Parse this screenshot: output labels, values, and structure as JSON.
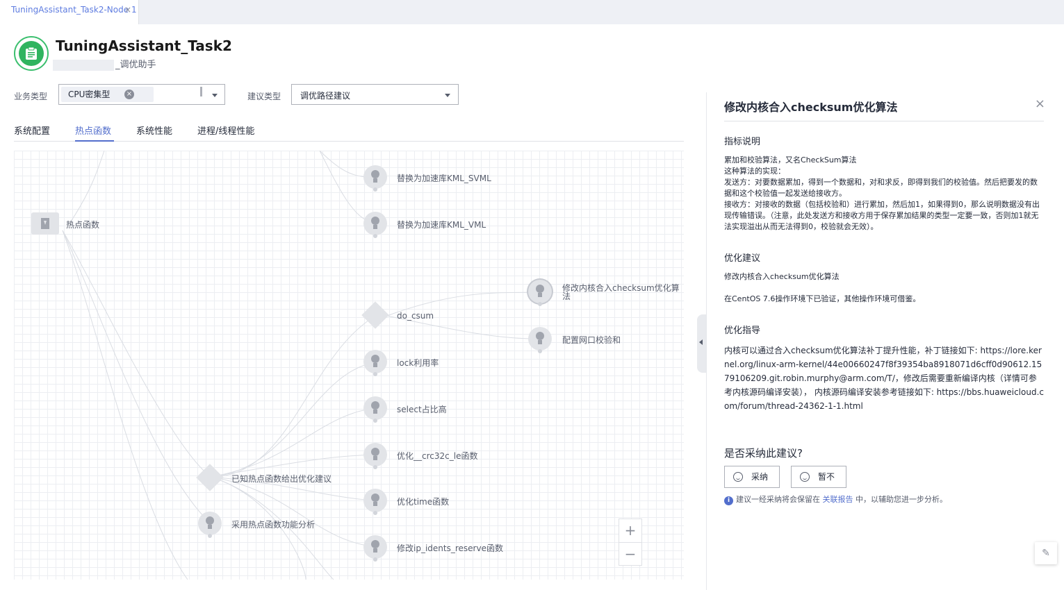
{
  "tab": {
    "label": "TuningAssistant_Task2-Node 1",
    "close": "×"
  },
  "header": {
    "title": "TuningAssistant_Task2",
    "subtitle": "_调优助手"
  },
  "filters": {
    "business_type_label": "业务类型",
    "business_type_value": "CPU密集型",
    "suggestion_type_label": "建议类型",
    "suggestion_type_value": "调优路径建议"
  },
  "nav": {
    "tabs": [
      "系统配置",
      "热点函数",
      "系统性能",
      "进程/线程性能"
    ],
    "active": "热点函数"
  },
  "graph": {
    "root": "热点函数",
    "nodes": {
      "svml": "替换为加速库KML_SVML",
      "vml": "替换为加速库KML_VML",
      "do_csum": "do_csum",
      "checksum": "修改内核合入checksum优化算法",
      "nic": "配置网口校验和",
      "lock": "lock利用率",
      "select": "select占比高",
      "crc32c": "优化__crc32c_le函数",
      "known": "已知热点函数给出优化建议",
      "time": "优化time函数",
      "adopt": "采用热点函数功能分析",
      "ipidents": "修改ip_idents_reserve函数"
    }
  },
  "zoom": {
    "plus": "+",
    "minus": "−"
  },
  "panel": {
    "title": "修改内核合入checksum优化算法",
    "close": "×",
    "sec_indicator": "指标说明",
    "indicator_lines": [
      "累加和校验算法，又名CheckSum算法",
      "这种算法的实现：",
      "发送方：对要数据累加，得到一个数据和，对和求反，即得到我们的校验值。然后把要发的数据和这个校验值一起发送给接收方。",
      "接收方：对接收的数据（包括校验和）进行累加，然后加1，如果得到0，那么说明数据没有出现传输错误。（注意，此处发送方和接收方用于保存累加结果的类型一定要一致，否则加1就无法实现溢出从而无法得到0，校验就会无效）。"
    ],
    "sec_suggestion": "优化建议",
    "suggestion_1": "修改内核合入checksum优化算法",
    "suggestion_2": "在CentOS 7.6操作环境下已验证，其他操作环境可借鉴。",
    "sec_guide": "优化指导",
    "guide_text": "内核可以通过合入checksum优化算法补丁提升性能，补丁链接如下: https://lore.kernel.org/linux-arm-kernel/44e00660247f8f39354ba8918071d6cff0d90612.1579106209.git.robin.murphy@arm.com/T/，修改后需要重新编译内核（详情可参考内核源码编译安装）， 内核源码编译安装参考链接如下: https://bbs.huaweicloud.com/forum/thread-24362-1-1.html",
    "question": "是否采纳此建议?",
    "adopt_label": "采纳",
    "skip_label": "暂不",
    "info_prefix": "建议一经采纳将会保留在",
    "info_link": "关联报告",
    "info_suffix": "中，以辅助您进一步分析。"
  }
}
